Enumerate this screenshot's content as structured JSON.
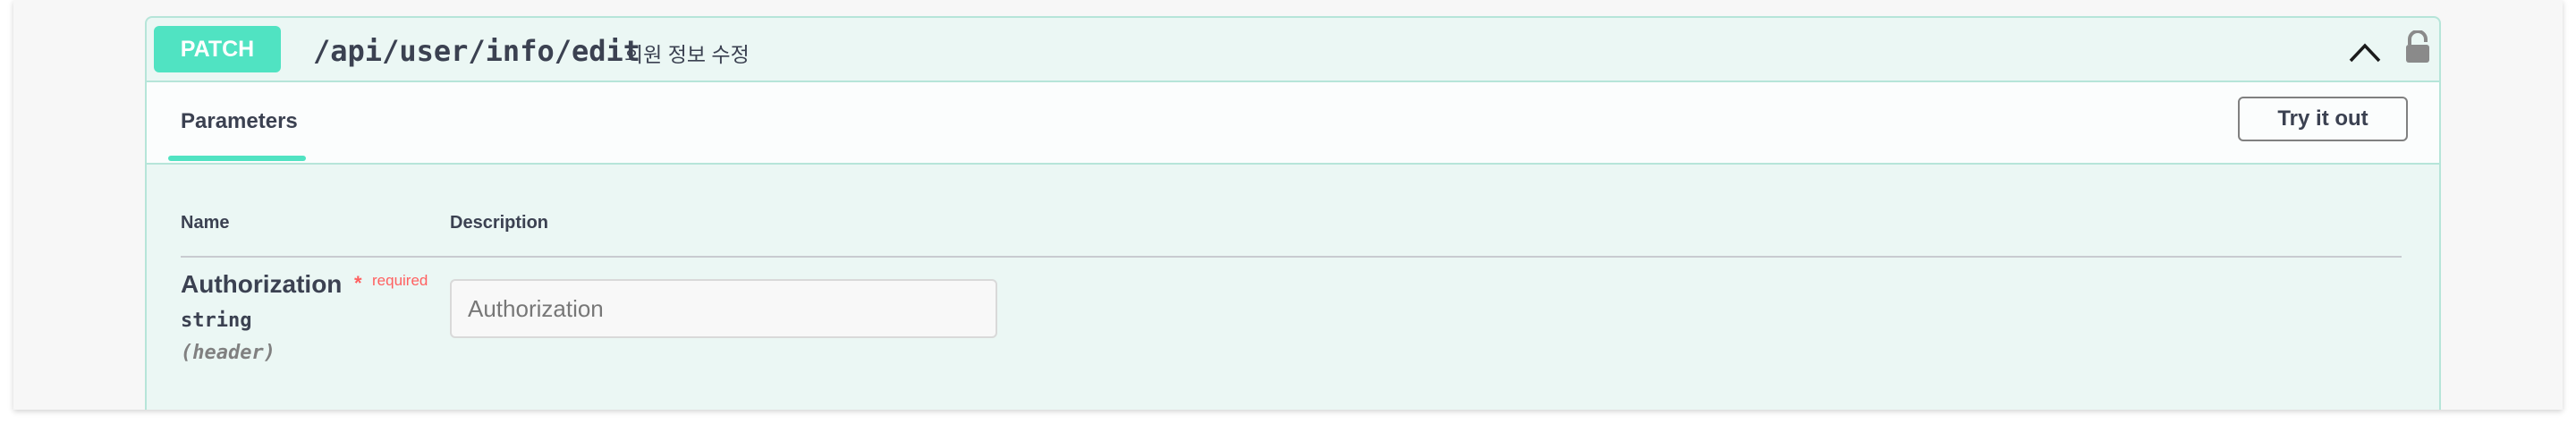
{
  "operation": {
    "method": "PATCH",
    "path": "/api/user/info/edit",
    "summary": "회원 정보 수정"
  },
  "tabs": {
    "parameters_label": "Parameters",
    "try_button_label": "Try it out"
  },
  "table": {
    "columns": [
      "Name",
      "Description"
    ],
    "parameters": [
      {
        "name": "Authorization",
        "required_star": "*",
        "required_label": "required",
        "type": "string",
        "location": "(header)",
        "input_placeholder": "Authorization",
        "input_value": ""
      }
    ]
  },
  "icons": {
    "collapse": "chevron-up-icon",
    "auth": "lock-icon"
  },
  "colors": {
    "method_patch": "#50e3c2",
    "block_background": "#ebf7f4",
    "block_border": "#b6e5d9",
    "required": "#ff6060"
  }
}
